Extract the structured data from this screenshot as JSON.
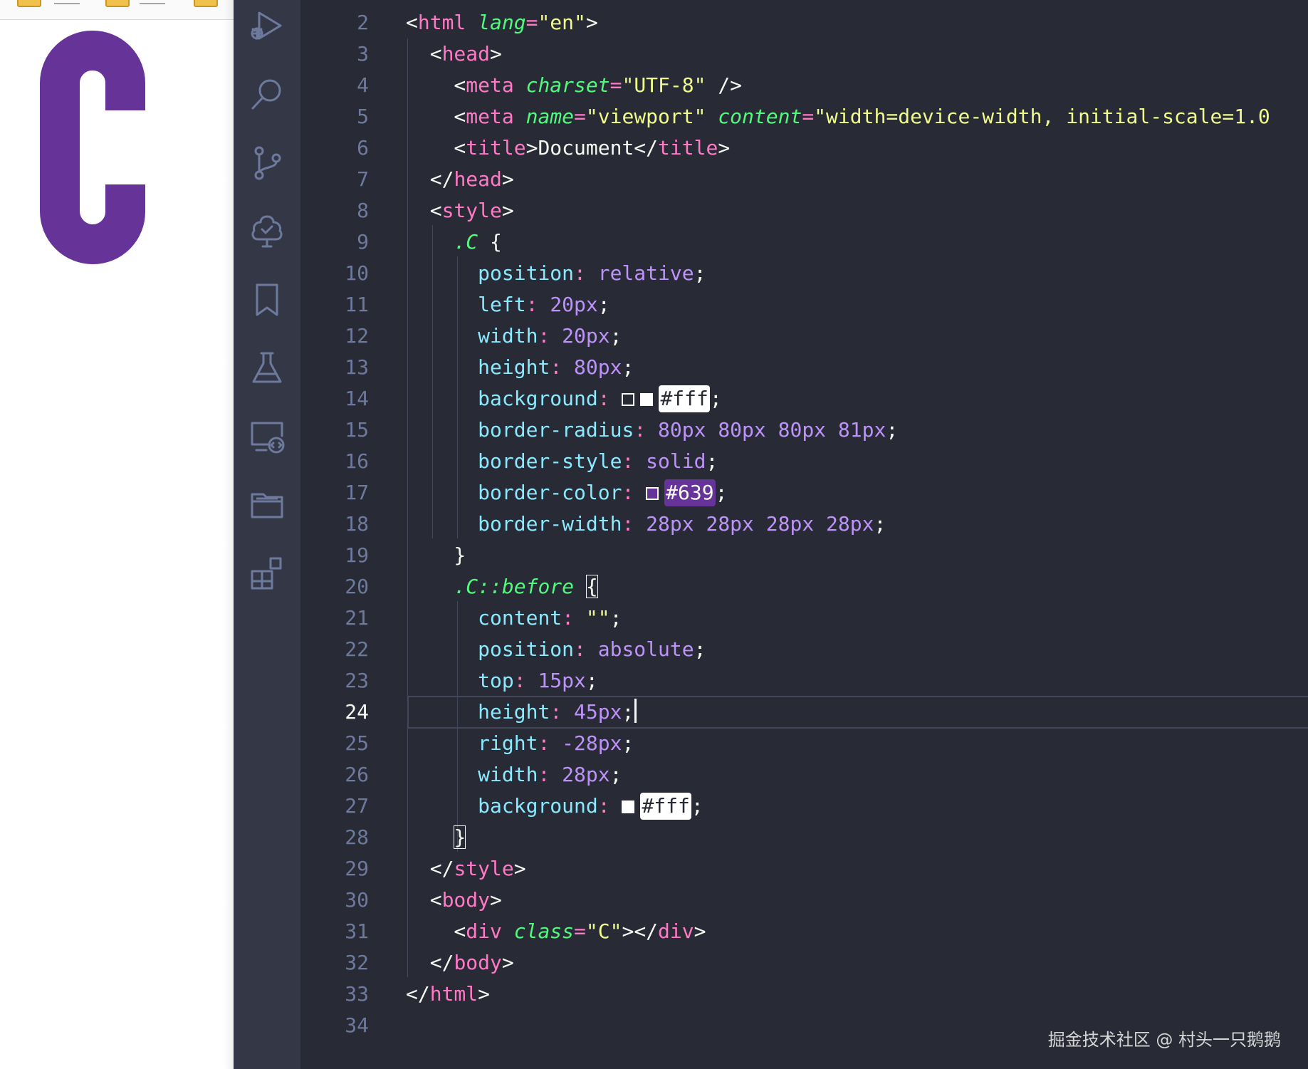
{
  "preview": {
    "rendered_letter_color": "#663399"
  },
  "activity_bar": {
    "icons": [
      "run-debug-icon",
      "search-icon",
      "source-control-icon",
      "testing-icon",
      "bookmark-icon",
      "flask-icon",
      "remote-explorer-icon",
      "folder-icon",
      "extensions-icon"
    ]
  },
  "editor": {
    "active_line": "24",
    "lines": [
      {
        "n": "2",
        "t": [
          [
            "t-punc",
            "<"
          ],
          [
            "t-tag",
            "html "
          ],
          [
            "t-attr",
            "lang"
          ],
          [
            "t-op",
            "="
          ],
          [
            "t-str",
            "\"en\""
          ],
          [
            "t-punc",
            ">"
          ]
        ]
      },
      {
        "n": "3",
        "t": [
          [
            "t-punc",
            "  <"
          ],
          [
            "t-tag",
            "head"
          ],
          [
            "t-punc",
            ">"
          ]
        ]
      },
      {
        "n": "4",
        "t": [
          [
            "t-punc",
            "    <"
          ],
          [
            "t-tag",
            "meta "
          ],
          [
            "t-attr",
            "charset"
          ],
          [
            "t-op",
            "="
          ],
          [
            "t-str",
            "\"UTF-8\" "
          ],
          [
            "t-punc",
            "/>"
          ]
        ]
      },
      {
        "n": "5",
        "t": [
          [
            "t-punc",
            "    <"
          ],
          [
            "t-tag",
            "meta "
          ],
          [
            "t-attr",
            "name"
          ],
          [
            "t-op",
            "="
          ],
          [
            "t-str",
            "\"viewport\" "
          ],
          [
            "t-attr",
            "content"
          ],
          [
            "t-op",
            "="
          ],
          [
            "t-str",
            "\"width=device-width, initial-scale=1.0"
          ]
        ]
      },
      {
        "n": "6",
        "t": [
          [
            "t-punc",
            "    <"
          ],
          [
            "t-tag",
            "title"
          ],
          [
            "t-punc",
            ">Document</"
          ],
          [
            "t-tag",
            "title"
          ],
          [
            "t-punc",
            ">"
          ]
        ]
      },
      {
        "n": "7",
        "t": [
          [
            "t-punc",
            "  </"
          ],
          [
            "t-tag",
            "head"
          ],
          [
            "t-punc",
            ">"
          ]
        ]
      },
      {
        "n": "8",
        "t": [
          [
            "t-punc",
            "  <"
          ],
          [
            "t-tag",
            "style"
          ],
          [
            "t-punc",
            ">"
          ]
        ]
      },
      {
        "n": "9",
        "t": [
          [
            "t-punc",
            "    "
          ],
          [
            "t-sel",
            ".C"
          ],
          [
            "t-punc",
            " {"
          ]
        ]
      },
      {
        "n": "10",
        "t": [
          [
            "t-punc",
            "      "
          ],
          [
            "t-prop",
            "position"
          ],
          [
            "t-op",
            ": "
          ],
          [
            "t-val",
            "relative"
          ],
          [
            "t-punc",
            ";"
          ]
        ]
      },
      {
        "n": "11",
        "t": [
          [
            "t-punc",
            "      "
          ],
          [
            "t-prop",
            "left"
          ],
          [
            "t-op",
            ": "
          ],
          [
            "t-val",
            "20px"
          ],
          [
            "t-punc",
            ";"
          ]
        ]
      },
      {
        "n": "12",
        "t": [
          [
            "t-punc",
            "      "
          ],
          [
            "t-prop",
            "width"
          ],
          [
            "t-op",
            ": "
          ],
          [
            "t-val",
            "20px"
          ],
          [
            "t-punc",
            ";"
          ]
        ]
      },
      {
        "n": "13",
        "t": [
          [
            "t-punc",
            "      "
          ],
          [
            "t-prop",
            "height"
          ],
          [
            "t-op",
            ": "
          ],
          [
            "t-val",
            "80px"
          ],
          [
            "t-punc",
            ";"
          ]
        ]
      },
      {
        "n": "14",
        "t": [
          [
            "t-punc",
            "      "
          ],
          [
            "t-prop",
            "background"
          ],
          [
            "t-op",
            ": "
          ],
          [
            "sw-outline",
            ""
          ],
          [
            "sw-white",
            ""
          ],
          [
            "chip-white",
            "#fff"
          ],
          [
            "t-punc",
            ";"
          ]
        ]
      },
      {
        "n": "15",
        "t": [
          [
            "t-punc",
            "      "
          ],
          [
            "t-prop",
            "border-radius"
          ],
          [
            "t-op",
            ": "
          ],
          [
            "t-val",
            "80px 80px 80px 81px"
          ],
          [
            "t-punc",
            ";"
          ]
        ]
      },
      {
        "n": "16",
        "t": [
          [
            "t-punc",
            "      "
          ],
          [
            "t-prop",
            "border-style"
          ],
          [
            "t-op",
            ": "
          ],
          [
            "t-val",
            "solid"
          ],
          [
            "t-punc",
            ";"
          ]
        ]
      },
      {
        "n": "17",
        "t": [
          [
            "t-punc",
            "      "
          ],
          [
            "t-prop",
            "border-color"
          ],
          [
            "t-op",
            ": "
          ],
          [
            "sw-purple",
            ""
          ],
          [
            "chip-purple",
            "#639"
          ],
          [
            "t-punc",
            ";"
          ]
        ]
      },
      {
        "n": "18",
        "t": [
          [
            "t-punc",
            "      "
          ],
          [
            "t-prop",
            "border-width"
          ],
          [
            "t-op",
            ": "
          ],
          [
            "t-val",
            "28px 28px 28px 28px"
          ],
          [
            "t-punc",
            ";"
          ]
        ]
      },
      {
        "n": "19",
        "t": [
          [
            "t-punc",
            "    }"
          ]
        ]
      },
      {
        "n": "20",
        "t": [
          [
            "t-punc",
            "    "
          ],
          [
            "t-sel",
            ".C::before"
          ],
          [
            "t-punc",
            " "
          ],
          [
            "box",
            "{"
          ]
        ]
      },
      {
        "n": "21",
        "t": [
          [
            "t-punc",
            "      "
          ],
          [
            "t-prop",
            "content"
          ],
          [
            "t-op",
            ": "
          ],
          [
            "t-str",
            "\"\""
          ],
          [
            "t-punc",
            ";"
          ]
        ]
      },
      {
        "n": "22",
        "t": [
          [
            "t-punc",
            "      "
          ],
          [
            "t-prop",
            "position"
          ],
          [
            "t-op",
            ": "
          ],
          [
            "t-val",
            "absolute"
          ],
          [
            "t-punc",
            ";"
          ]
        ]
      },
      {
        "n": "23",
        "t": [
          [
            "t-punc",
            "      "
          ],
          [
            "t-prop",
            "top"
          ],
          [
            "t-op",
            ": "
          ],
          [
            "t-val",
            "15px"
          ],
          [
            "t-punc",
            ";"
          ]
        ]
      },
      {
        "n": "24",
        "t": [
          [
            "t-punc",
            "      "
          ],
          [
            "t-prop",
            "height"
          ],
          [
            "t-op",
            ": "
          ],
          [
            "t-val",
            "45px"
          ],
          [
            "t-punc",
            ";"
          ],
          [
            "caret",
            ""
          ]
        ]
      },
      {
        "n": "25",
        "t": [
          [
            "t-punc",
            "      "
          ],
          [
            "t-prop",
            "right"
          ],
          [
            "t-op",
            ": "
          ],
          [
            "t-val",
            "-28px"
          ],
          [
            "t-punc",
            ";"
          ]
        ]
      },
      {
        "n": "26",
        "t": [
          [
            "t-punc",
            "      "
          ],
          [
            "t-prop",
            "width"
          ],
          [
            "t-op",
            ": "
          ],
          [
            "t-val",
            "28px"
          ],
          [
            "t-punc",
            ";"
          ]
        ]
      },
      {
        "n": "27",
        "t": [
          [
            "t-punc",
            "      "
          ],
          [
            "t-prop",
            "background"
          ],
          [
            "t-op",
            ": "
          ],
          [
            "sw-white",
            ""
          ],
          [
            "chip-white",
            "#fff"
          ],
          [
            "t-punc",
            ";"
          ]
        ]
      },
      {
        "n": "28",
        "t": [
          [
            "t-punc",
            "    "
          ],
          [
            "box",
            "}"
          ]
        ]
      },
      {
        "n": "29",
        "t": [
          [
            "t-punc",
            "  </"
          ],
          [
            "t-tag",
            "style"
          ],
          [
            "t-punc",
            ">"
          ]
        ]
      },
      {
        "n": "30",
        "t": [
          [
            "t-punc",
            "  <"
          ],
          [
            "t-tag",
            "body"
          ],
          [
            "t-punc",
            ">"
          ]
        ]
      },
      {
        "n": "31",
        "t": [
          [
            "t-punc",
            "    <"
          ],
          [
            "t-tag",
            "div "
          ],
          [
            "t-attr",
            "class"
          ],
          [
            "t-op",
            "="
          ],
          [
            "t-str",
            "\"C\""
          ],
          [
            "t-punc",
            "></"
          ],
          [
            "t-tag",
            "div"
          ],
          [
            "t-punc",
            ">"
          ]
        ]
      },
      {
        "n": "32",
        "t": [
          [
            "t-punc",
            "  </"
          ],
          [
            "t-tag",
            "body"
          ],
          [
            "t-punc",
            ">"
          ]
        ]
      },
      {
        "n": "33",
        "t": [
          [
            "t-punc",
            "</"
          ],
          [
            "t-tag",
            "html"
          ],
          [
            "t-punc",
            ">"
          ]
        ]
      },
      {
        "n": "34",
        "t": []
      }
    ]
  },
  "watermark": "掘金技术社区 @ 村头一只鹅鹅"
}
